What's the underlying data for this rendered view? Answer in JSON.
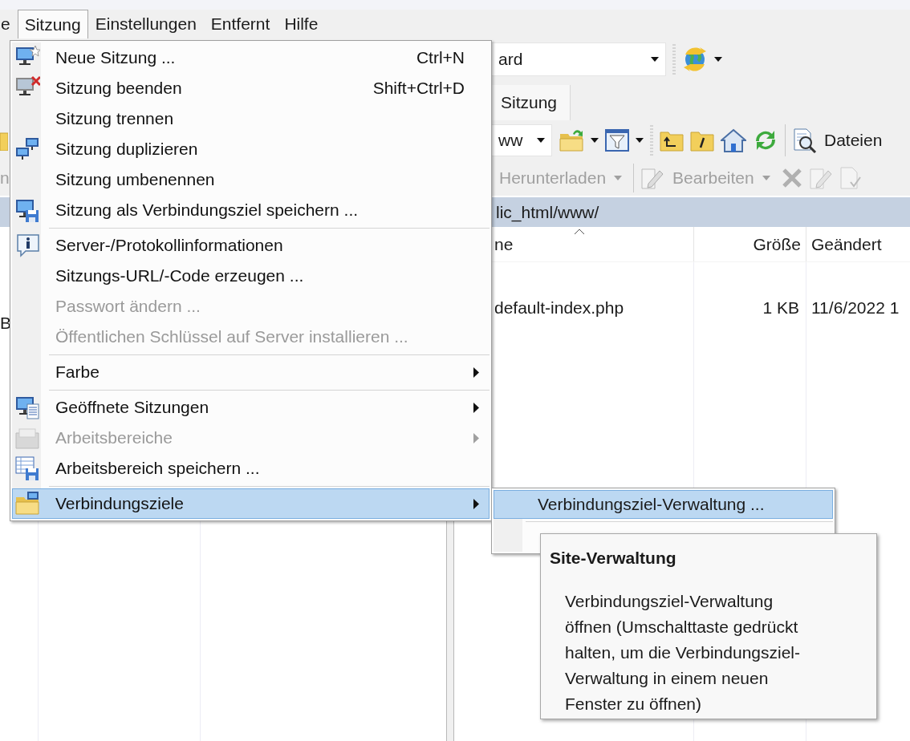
{
  "menu_bar": [
    {
      "label": "e",
      "selected": false
    },
    {
      "label": "Sitzung",
      "selected": true
    },
    {
      "label": "Einstellungen",
      "selected": false
    },
    {
      "label": "Entfernt",
      "selected": false
    },
    {
      "label": "Hilfe",
      "selected": false
    }
  ],
  "address_combo": {
    "value": "ard"
  },
  "tabs": [
    {
      "label": "Sitzung",
      "selected": true
    }
  ],
  "remote_toolbar": {
    "path_combo": "ww",
    "find_button": "Dateien"
  },
  "action_toolbar": {
    "left_fragment": "n",
    "buttons": [
      {
        "label": "Herunterladen",
        "disabled": true
      },
      {
        "label": "Bearbeiten",
        "disabled": true
      }
    ]
  },
  "path_bar": {
    "right": "lic_html/www/"
  },
  "left_pane": {
    "cell_fragment": "B"
  },
  "file_list": {
    "columns": [
      {
        "label": "ne",
        "sorted": true
      },
      {
        "label": "Größe",
        "sorted": false
      },
      {
        "label": "Geändert",
        "sorted": false
      }
    ],
    "rows": [
      {
        "name": "default-index.php",
        "size": "1 KB",
        "changed": "11/6/2022 1"
      }
    ]
  },
  "menu": [
    {
      "kind": "item",
      "label": "Neue Sitzung ...",
      "shortcut": "Ctrl+N",
      "disabled": false,
      "submenu": false,
      "selected": false
    },
    {
      "kind": "item",
      "label": "Sitzung beenden",
      "shortcut": "Shift+Ctrl+D",
      "disabled": false,
      "submenu": false,
      "selected": false
    },
    {
      "kind": "item",
      "label": "Sitzung trennen",
      "disabled": false,
      "submenu": false,
      "selected": false
    },
    {
      "kind": "item",
      "label": "Sitzung duplizieren",
      "disabled": false,
      "submenu": false,
      "selected": false
    },
    {
      "kind": "item",
      "label": "Sitzung umbenennen",
      "disabled": false,
      "submenu": false,
      "selected": false
    },
    {
      "kind": "item",
      "label": "Sitzung als Verbindungsziel speichern ...",
      "disabled": false,
      "submenu": false,
      "selected": false
    },
    {
      "kind": "separator"
    },
    {
      "kind": "item",
      "label": "Server-/Protokollinformationen",
      "disabled": false,
      "submenu": false,
      "selected": false
    },
    {
      "kind": "item",
      "label": "Sitzungs-URL/-Code erzeugen ...",
      "disabled": false,
      "submenu": false,
      "selected": false
    },
    {
      "kind": "item",
      "label": "Passwort ändern ...",
      "disabled": true,
      "submenu": false,
      "selected": false
    },
    {
      "kind": "item",
      "label": "Öffentlichen Schlüssel auf Server installieren ...",
      "disabled": true,
      "submenu": false,
      "selected": false
    },
    {
      "kind": "separator"
    },
    {
      "kind": "item",
      "label": "Farbe",
      "disabled": false,
      "submenu": true,
      "selected": false
    },
    {
      "kind": "separator"
    },
    {
      "kind": "item",
      "label": "Geöffnete Sitzungen",
      "disabled": false,
      "submenu": true,
      "selected": false
    },
    {
      "kind": "item",
      "label": "Arbeitsbereiche",
      "disabled": true,
      "submenu": true,
      "selected": false
    },
    {
      "kind": "item",
      "label": "Arbeitsbereich speichern ...",
      "disabled": false,
      "submenu": false,
      "selected": false
    },
    {
      "kind": "separator"
    },
    {
      "kind": "item",
      "label": "Verbindungsziele",
      "disabled": false,
      "submenu": true,
      "selected": true
    }
  ],
  "submenu": [
    {
      "kind": "item",
      "label": "Verbindungsziel-Verwaltung ...",
      "selected": true
    },
    {
      "kind": "separator"
    }
  ],
  "tooltip": {
    "title": "Site-Verwaltung",
    "text": "Verbindungsziel-Verwaltung öffnen (Umschalttaste gedrückt halten, um die Verbindungsziel-Verwaltung in einem neuen Fenster zu öffnen)"
  }
}
